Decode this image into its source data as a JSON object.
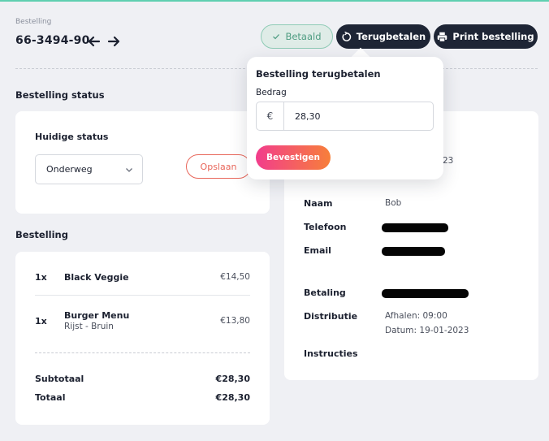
{
  "header": {
    "breadcrumb": "Bestelling",
    "order_id": "66-3494-90",
    "paid_label": "Betaald",
    "refund_label": "Terugbetalen",
    "print_label": "Print bestelling"
  },
  "status_section": {
    "title": "Bestelling status",
    "current_label": "Huidige status",
    "selected_status": "Onderweg",
    "save_label": "Opslaan"
  },
  "order_section": {
    "title": "Bestelling",
    "items": [
      {
        "qty": "1x",
        "name": "Black Veggie",
        "sub": "",
        "price": "€14,50"
      },
      {
        "qty": "1x",
        "name": "Burger Menu",
        "sub": "Rijst - Bruin",
        "price": "€13,80"
      }
    ],
    "subtotal_label": "Subtotaal",
    "subtotal_value": "€28,30",
    "total_label": "Totaal",
    "total_value": "€28,30"
  },
  "customer": {
    "partial_date": "23",
    "name_label": "Naam",
    "name_value": "Bob",
    "phone_label": "Telefoon",
    "email_label": "Email",
    "payment_label": "Betaling",
    "distribution_label": "Distributie",
    "distribution_line1": "Afhalen: 09:00",
    "distribution_line2": "Datum: 19-01-2023",
    "instructions_label": "Instructies"
  },
  "refund_popover": {
    "title": "Bestelling terugbetalen",
    "amount_label": "Bedrag",
    "currency": "€",
    "amount_value": "28,30",
    "confirm_label": "Bevestigen"
  },
  "colors": {
    "accent_teal": "#5fcfb0",
    "dark_button": "#1e2535",
    "save_red": "#e8665a",
    "confirm_gradient_start": "#f23d8c",
    "confirm_gradient_end": "#f77f3a"
  }
}
